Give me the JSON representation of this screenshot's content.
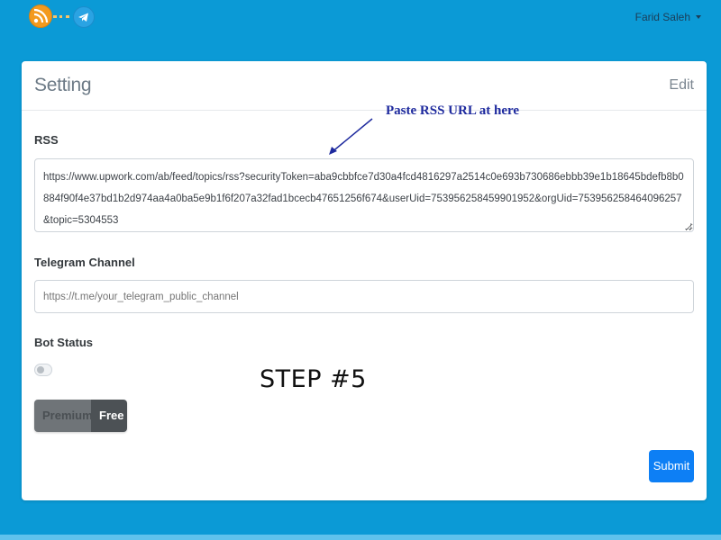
{
  "navbar": {
    "logo_icon": "rss-telegram-logo",
    "user_name": "Farid Saleh"
  },
  "card": {
    "title": "Setting",
    "edit_label": "Edit",
    "annotation": "Paste RSS URL at here",
    "rss": {
      "label": "RSS",
      "value": "https://www.upwork.com/ab/feed/topics/rss?securityToken=aba9cbbfce7d30a4fcd4816297a2514c0e693b730686ebbb39e1b18645bdefb8b0884f90f4e37bd1b2d974aa4a0ba5e9b1f6f207a32fad1bcecb47651256f674&userUid=753956258459901952&orgUid=753956258464096257&topic=5304553"
    },
    "telegram": {
      "label": "Telegram Channel",
      "placeholder": "https://t.me/your_telegram_public_channel"
    },
    "bot_status": {
      "label": "Bot Status",
      "enabled": false
    },
    "step_text": "STEP #5",
    "plans": {
      "premium_label": "Premium",
      "free_label": "Free",
      "selected": "Free"
    },
    "submit_label": "Submit"
  },
  "colors": {
    "background": "#0b9ad6",
    "submit": "#0d7ff5",
    "annotation": "#1e2a9e"
  }
}
